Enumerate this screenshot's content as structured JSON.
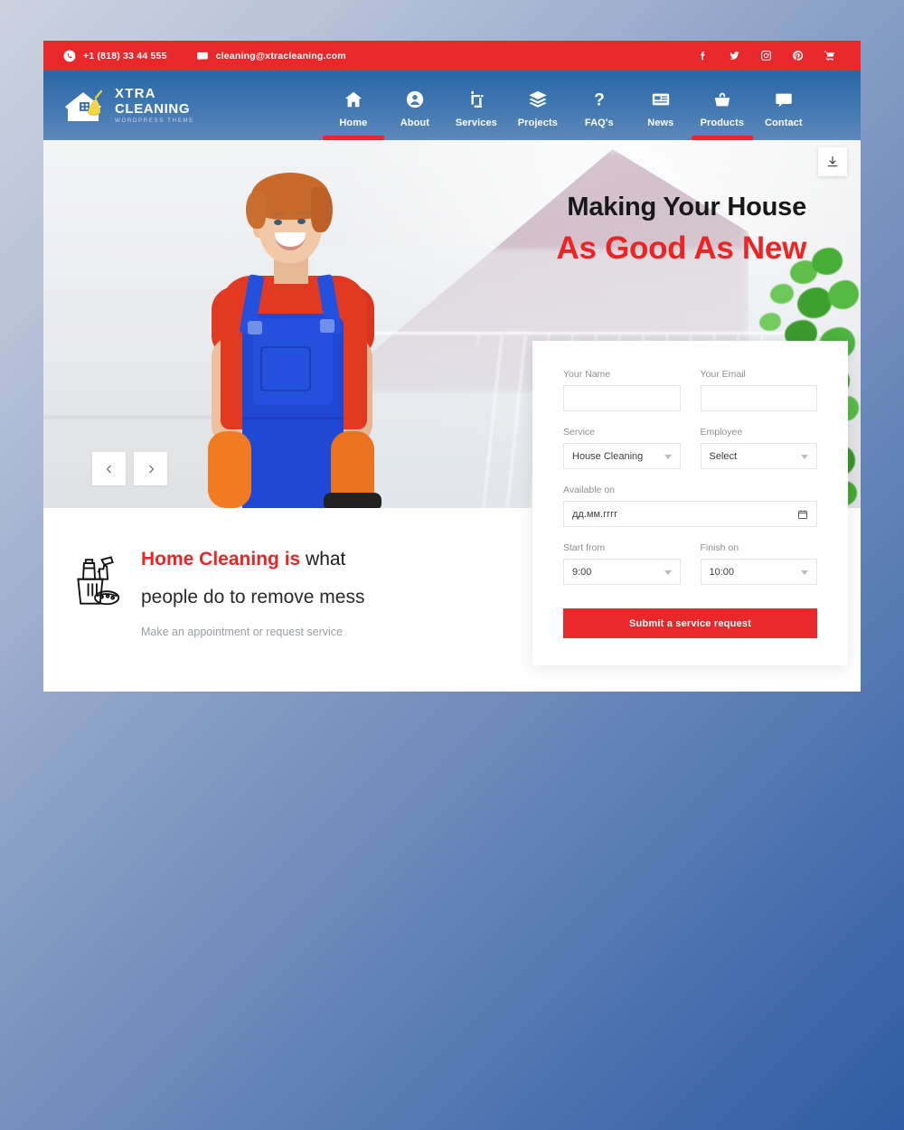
{
  "topbar": {
    "phone": "+1 (818) 33 44 555",
    "email": "cleaning@xtracleaning.com",
    "phone_icon": "phone-icon",
    "email_icon": "message-icon",
    "socials": [
      {
        "name": "facebook-icon",
        "label": "f"
      },
      {
        "name": "twitter-icon",
        "label": "t"
      },
      {
        "name": "instagram-icon",
        "label": "i"
      },
      {
        "name": "pinterest-icon",
        "label": "p"
      },
      {
        "name": "cart-icon",
        "label": "c"
      }
    ],
    "bg_color": "#e8282b"
  },
  "logo": {
    "line1": "XTRA",
    "line2": "CLEANING",
    "line3": "WORDPRESS THEME",
    "mark": "house-with-broom-icon"
  },
  "nav": {
    "items": [
      {
        "label": "Home",
        "icon": "home-icon",
        "active": true
      },
      {
        "label": "About",
        "icon": "user-icon",
        "active": false
      },
      {
        "label": "Services",
        "icon": "crop-icon",
        "active": false
      },
      {
        "label": "Projects",
        "icon": "layers-icon",
        "active": false
      },
      {
        "label": "FAQ's",
        "icon": "question-icon",
        "active": false
      },
      {
        "label": "News",
        "icon": "list-icon",
        "active": false
      },
      {
        "label": "Products",
        "icon": "basket-icon",
        "active": true
      },
      {
        "label": "Contact",
        "icon": "chat-icon",
        "active": false
      }
    ],
    "accent_color": "#e8282b"
  },
  "hero": {
    "headline_line1": "Making Your House",
    "headline_line2": "As Good As New",
    "headline_color": "#ee2323",
    "prev_label": "‹",
    "next_label": "›",
    "download_icon": "download-icon",
    "image_alt": "cleaning-worker-photo"
  },
  "form": {
    "name_label": "Your Name",
    "name_value": "",
    "name_placeholder": "",
    "email_label": "Your Email",
    "email_value": "",
    "email_placeholder": "",
    "service_label": "Service",
    "service_value": "House Cleaning",
    "employee_label": "Employee",
    "employee_value": "Select",
    "date_label": "Available on",
    "date_value": "дд.мм.гггг",
    "start_label": "Start from",
    "start_value": "9:00",
    "finish_label": "Finish on",
    "finish_value": "10:00",
    "submit_label": "Submit a service request",
    "submit_color": "#e8282b"
  },
  "band": {
    "icon": "cleaning-supplies-icon",
    "heading_strong": "Home Cleaning is",
    "heading_rest": " what",
    "heading_line2": "people do to remove mess",
    "subtext": "Make an appointment or request service"
  }
}
